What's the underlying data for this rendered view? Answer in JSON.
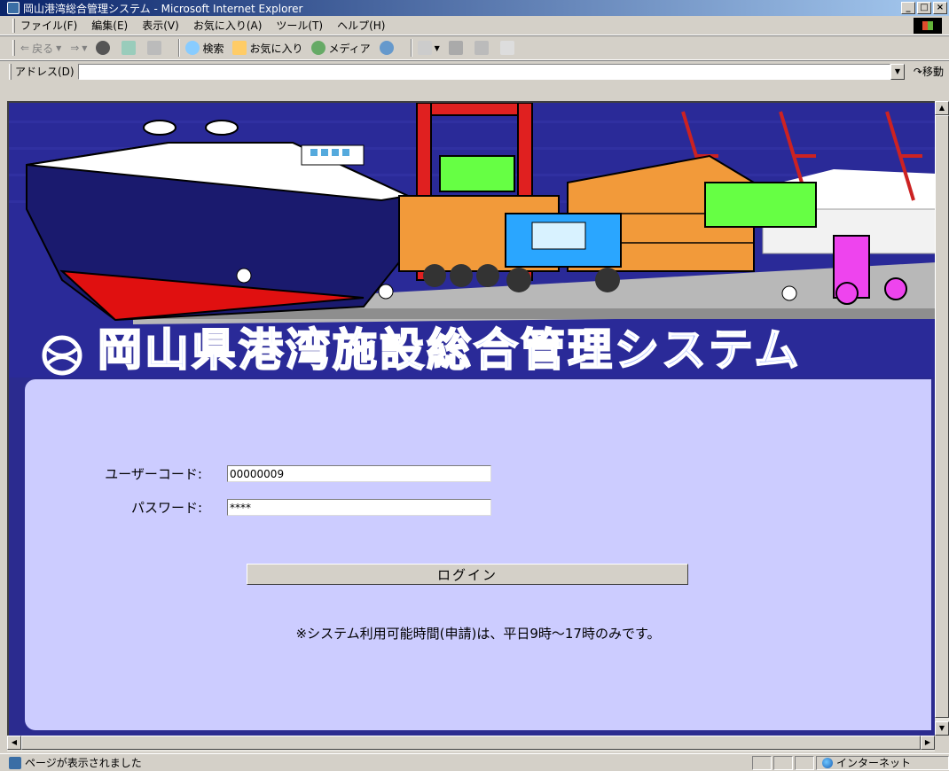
{
  "window": {
    "title": "岡山港湾総合管理システム - Microsoft Internet Explorer"
  },
  "menu": [
    "ファイル(F)",
    "編集(E)",
    "表示(V)",
    "お気に入り(A)",
    "ツール(T)",
    "ヘルプ(H)"
  ],
  "toolbar": {
    "back": "戻る",
    "search": "検索",
    "favorites": "お気に入り",
    "media": "メディア"
  },
  "address": {
    "label": "アドレス(D)",
    "value": "",
    "go": "移動"
  },
  "banner": {
    "title": "岡山県港湾施設総合管理システム"
  },
  "login": {
    "user_code_label": "ユーザーコード:",
    "user_code_value": "00000009",
    "password_label": "パスワード:",
    "password_value": "****",
    "button_label": "ログイン",
    "notice": "※システム利用可能時間(申請)は、平日9時～17時のみです。"
  },
  "status": {
    "message": "ページが表示されました",
    "zone": "インターネット"
  },
  "colors": {
    "banner_bg": "#2b2b9a",
    "panel_bg": "#ccccff",
    "title_text": "#8fa8ff"
  }
}
